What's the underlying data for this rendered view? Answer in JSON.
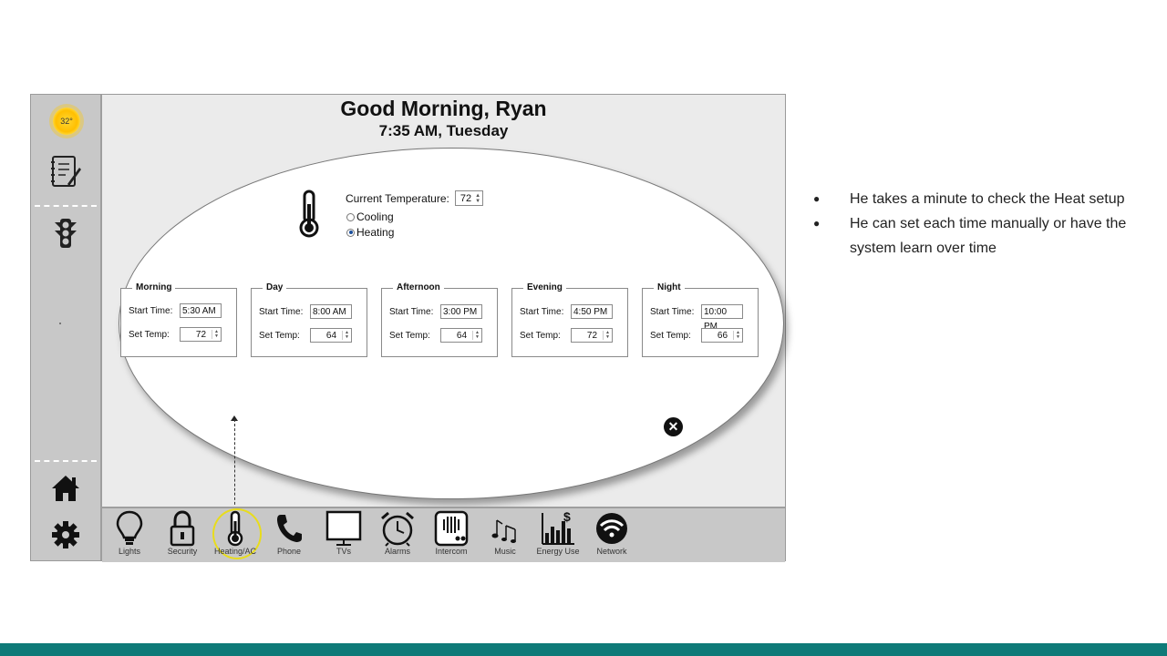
{
  "app": {
    "greeting": "Good Morning, Ryan",
    "time_line": "7:35 AM, Tuesday"
  },
  "sidebar": {
    "weather_temp": "32°",
    "icons": [
      "sun-weather-icon",
      "notes-checklist-icon",
      "traffic-light-icon",
      "home-icon",
      "gear-icon"
    ]
  },
  "heating_panel": {
    "current_temp_label": "Current Temperature:",
    "current_temp_value": "72",
    "mode_options": [
      {
        "label": "Cooling",
        "selected": false
      },
      {
        "label": "Heating",
        "selected": true
      }
    ],
    "start_time_label": "Start Time:",
    "set_temp_label": "Set Temp:",
    "periods": [
      {
        "name": "Morning",
        "start_time": "5:30 AM",
        "set_temp": "72"
      },
      {
        "name": "Day",
        "start_time": "8:00 AM",
        "set_temp": "64"
      },
      {
        "name": "Afternoon",
        "start_time": "3:00 PM",
        "set_temp": "64"
      },
      {
        "name": "Evening",
        "start_time": "4:50 PM",
        "set_temp": "72"
      },
      {
        "name": "Night",
        "start_time": "10:00 PM",
        "set_temp": "66"
      }
    ],
    "close_icon": "close-icon"
  },
  "bottom_nav": {
    "items": [
      {
        "label": "Lights",
        "icon": "lightbulb-icon"
      },
      {
        "label": "Security",
        "icon": "lock-icon"
      },
      {
        "label": "Heating/AC",
        "icon": "thermometer-icon",
        "highlighted": true
      },
      {
        "label": "Phone",
        "icon": "phone-icon"
      },
      {
        "label": "TVs",
        "icon": "tv-icon"
      },
      {
        "label": "Alarms",
        "icon": "alarm-clock-icon"
      },
      {
        "label": "Intercom",
        "icon": "intercom-icon"
      },
      {
        "label": "Music",
        "icon": "music-note-icon"
      },
      {
        "label": "Energy Use",
        "icon": "energy-chart-icon"
      },
      {
        "label": "Network",
        "icon": "wifi-icon"
      }
    ]
  },
  "notes": {
    "bullets": [
      "He takes a minute to check the Heat setup",
      "He can set each time manually or have the system learn over time"
    ]
  },
  "colors": {
    "footer_bar": "#0e7a78",
    "highlight_ring": "#e8dc1c",
    "sidebar_bg": "#c8c8c8"
  }
}
